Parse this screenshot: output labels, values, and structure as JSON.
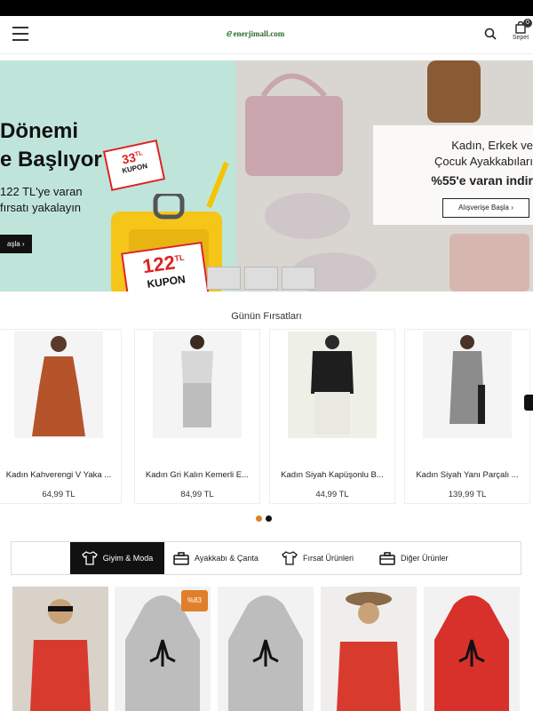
{
  "header": {
    "logo_text": "enerjimall.com",
    "cart_label": "Sepet",
    "cart_count": "0"
  },
  "banner": {
    "left": {
      "title_line1": "Dönemi",
      "title_line2": "e Başlıyor",
      "sub_line1": "122 TL'ye varan",
      "sub_line2": "fırsatı yakalayın",
      "button": "aşla",
      "coupon_small_value": "33",
      "coupon_small_unit": "TL",
      "coupon_small_label": "KUPON",
      "coupon_big_value": "122",
      "coupon_big_unit": "TL",
      "coupon_big_label": "KUPON"
    },
    "right": {
      "line1": "Kadın, Erkek ve",
      "line2": "Çocuk Ayakkabıları",
      "line3": "%55'e varan indir",
      "button": "Alışverişe Başla"
    }
  },
  "deals": {
    "title": "Günün Fırsatları",
    "items": [
      {
        "name": "Kadın Kahverengi V Yaka ...",
        "price": "64,99 TL"
      },
      {
        "name": "Kadın Gri Kalın Kemerli E...",
        "price": "84,99 TL"
      },
      {
        "name": "Kadın Siyah Kapüşonlu B...",
        "price": "44,99 TL"
      },
      {
        "name": "Kadın Siyah Yanı Parçalı ...",
        "price": "139,99 TL"
      }
    ]
  },
  "categories": {
    "tabs": [
      {
        "label": "Giyim & Moda",
        "icon": "tshirt-icon"
      },
      {
        "label": "Ayakkabı & Çanta",
        "icon": "bag-icon"
      },
      {
        "label": "Fırsat Ürünleri",
        "icon": "tshirt-icon"
      },
      {
        "label": "Diğer Ürünler",
        "icon": "bag-icon"
      }
    ]
  },
  "grid": {
    "discount_badge": "%83"
  },
  "colors": {
    "accent": "#e07f2a",
    "coupon_red": "#d22222",
    "banner_left_bg": "#bfe5db",
    "dark": "#111111"
  }
}
